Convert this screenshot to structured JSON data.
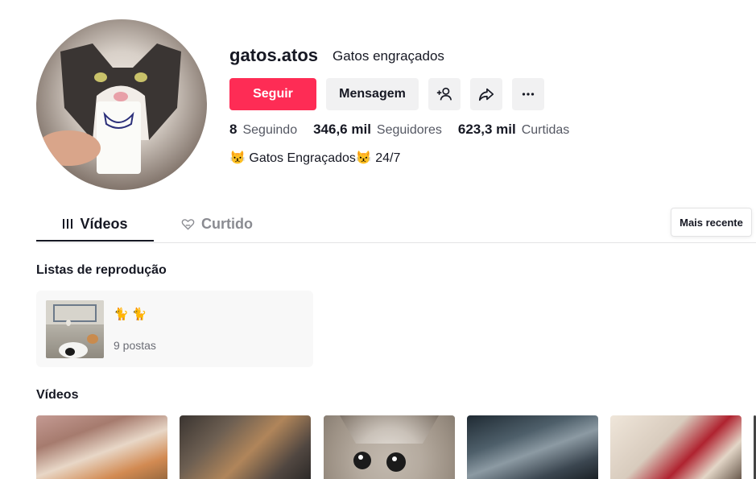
{
  "profile": {
    "username": "gatos.atos",
    "nickname": "Gatos engraçados",
    "bio": "😾 Gatos Engraçados😾 24/7"
  },
  "actions": {
    "follow_label": "Seguir",
    "message_label": "Mensagem",
    "add_user_icon": "person-plus-icon",
    "share_icon": "share-arrow-icon",
    "more_icon": "more-dots-icon"
  },
  "stats": [
    {
      "value": "8",
      "label": "Seguindo"
    },
    {
      "value": "346,6 mil",
      "label": "Seguidores"
    },
    {
      "value": "623,3 mil",
      "label": "Curtidas"
    }
  ],
  "tabs": [
    {
      "label": "Vídeos",
      "icon": "grid-bars-icon",
      "active": true
    },
    {
      "label": "Curtido",
      "icon": "hidden-heart-icon",
      "active": false
    }
  ],
  "sort": {
    "label": "Mais recente"
  },
  "playlists": {
    "title": "Listas de reprodução",
    "items": [
      {
        "name": "🐈 🐈",
        "count": "9 postas"
      }
    ]
  },
  "videos": {
    "title": "Vídeos"
  },
  "colors": {
    "accent": "#fe2c55",
    "button_bg": "#f1f1f2",
    "text": "#161823",
    "muted": "#555863"
  }
}
